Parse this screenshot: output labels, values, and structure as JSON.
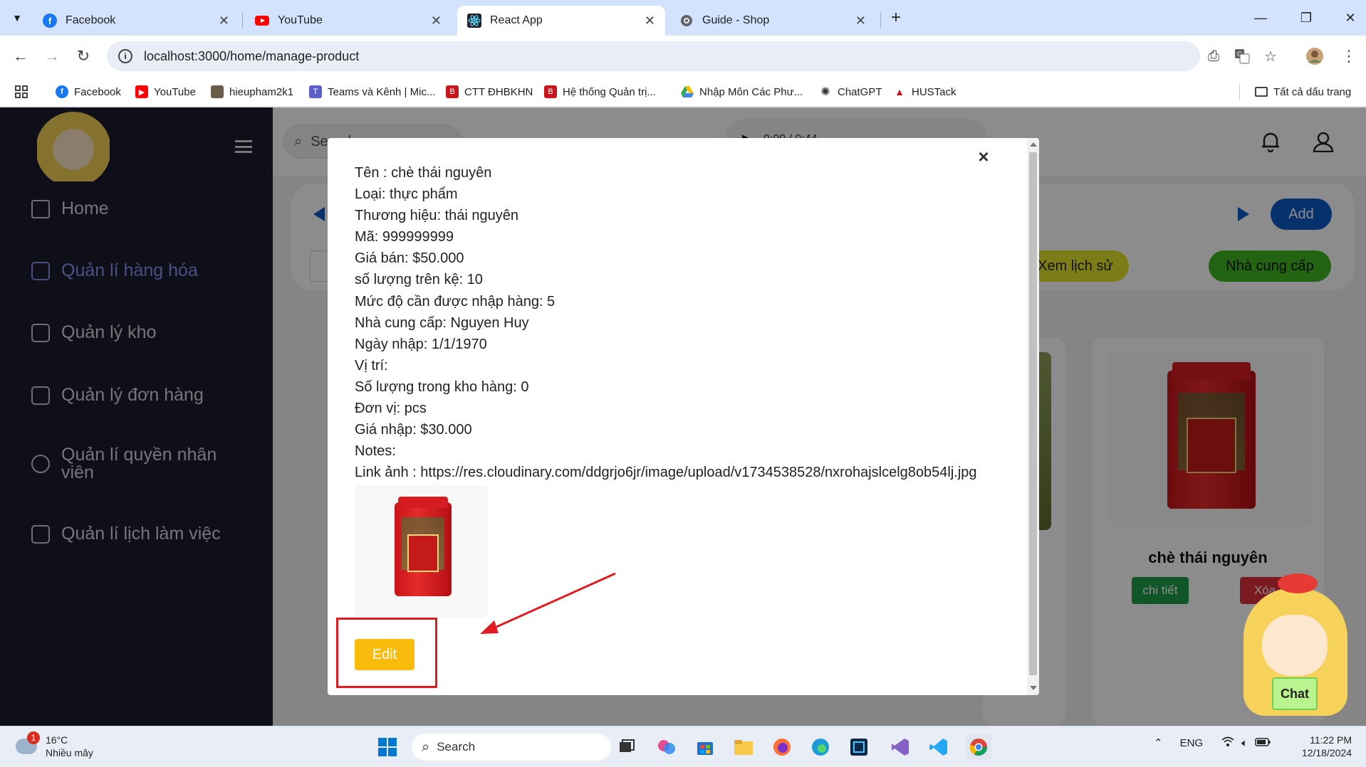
{
  "browser": {
    "tabs": [
      {
        "title": "Facebook",
        "icon": "facebook-icon",
        "active": false
      },
      {
        "title": "YouTube",
        "icon": "youtube-icon",
        "active": false
      },
      {
        "title": "React App",
        "icon": "react-icon",
        "active": true
      },
      {
        "title": "Guide - Shop",
        "icon": "globe-icon",
        "active": false
      }
    ],
    "url": "localhost:3000/home/manage-product",
    "bookmarks": [
      {
        "label": "Facebook",
        "icon": "facebook-icon"
      },
      {
        "label": "YouTube",
        "icon": "youtube-icon"
      },
      {
        "label": "hieupham2k1",
        "icon": "avatar-icon"
      },
      {
        "label": "Teams và Kênh | Mic...",
        "icon": "teams-icon"
      },
      {
        "label": "CTT ĐHBKHN",
        "icon": "hust-icon"
      },
      {
        "label": "Hệ thống Quản trị...",
        "icon": "hust-icon"
      },
      {
        "label": "Nhập Môn Các Phư...",
        "icon": "drive-icon"
      },
      {
        "label": "ChatGPT",
        "icon": "chatgpt-icon"
      },
      {
        "label": "HUSTack",
        "icon": "hustack-icon"
      }
    ],
    "all_bookmarks": "Tất cả dấu trang"
  },
  "sidebar": {
    "items": [
      {
        "label": "Home",
        "icon": "home-icon",
        "active": false
      },
      {
        "label": "Quản lí hàng hóa",
        "icon": "clipboard-icon",
        "active": true
      },
      {
        "label": "Quản lý kho",
        "icon": "box-icon",
        "active": false
      },
      {
        "label": "Quản lý đơn hàng",
        "icon": "box-icon",
        "active": false
      },
      {
        "label": "Quản lí quyền nhân viên",
        "icon": "plus-circle-icon",
        "active": false
      },
      {
        "label": "Quản lí lịch làm việc",
        "icon": "calendar-icon",
        "active": false
      }
    ]
  },
  "header": {
    "search_placeholder": "Search",
    "audio_time": "0:00 / 0:44"
  },
  "panel": {
    "add_label": "Add",
    "history_label": "Xem lịch sử",
    "supplier_label": "Nhà cung cấp"
  },
  "product_card": {
    "title": "chè thái nguyên",
    "detail_label": "chi tiết",
    "delete_label": "Xóa"
  },
  "modal": {
    "lines": [
      "Tên : chè thái nguyên",
      "Loại: thực phẩm",
      "Thương hiệu: thái nguyên",
      "Mã: 999999999",
      "Giá bán: $50.000",
      "số lượng trên kệ: 10",
      "Mức độ cần được nhập hàng: 5",
      "Nhà cung cấp: Nguyen Huy",
      "Ngày nhập: 1/1/1970",
      "Vị trí:",
      "Số lượng trong kho hàng: 0",
      "Đơn vị: pcs",
      "Giá nhập: $30.000",
      "Notes:",
      "Link ảnh : https://res.cloudinary.com/ddgrjo6jr/image/upload/v1734538528/nxrohajslcelg8ob54lj.jpg"
    ],
    "edit_label": "Edit",
    "close_label": "×"
  },
  "chat": {
    "label": "Chat"
  },
  "taskbar": {
    "weather_temp": "16°C",
    "weather_desc": "Nhiều mây",
    "weather_badge": "1",
    "search_label": "Search",
    "lang": "ENG",
    "time": "11:22 PM",
    "date": "12/18/2024"
  },
  "colors": {
    "accent_blue": "#0a59c7",
    "edit_yellow": "#f9bc0c",
    "highlight_red": "#e11b22",
    "sidebar_bg": "#1b1c2e",
    "sidebar_active": "#8b8ef0"
  }
}
